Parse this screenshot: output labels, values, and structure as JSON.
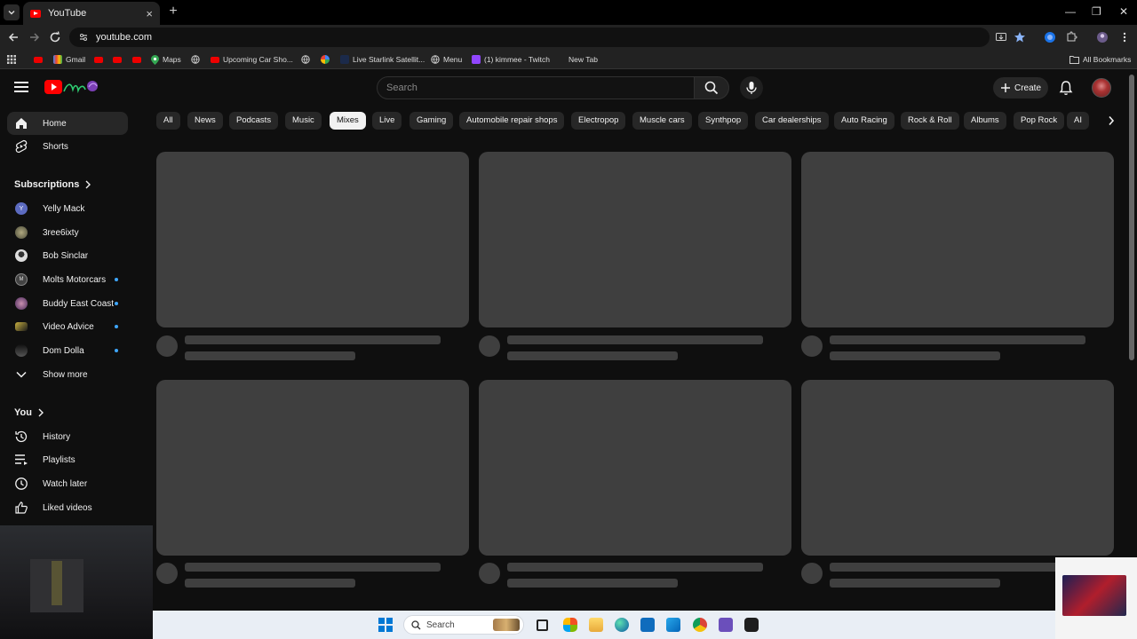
{
  "browser": {
    "tab_title": "YouTube",
    "tab_close": "×",
    "new_tab": "+",
    "url": "youtube.com",
    "window_controls": [
      "—",
      "❐",
      "✕"
    ],
    "bookmarks": [
      {
        "label": "Gmail",
        "icon": "gmail-icon"
      },
      {
        "label": "Maps",
        "icon": "maps-icon"
      },
      {
        "label": "Upcoming Car Sho...",
        "icon": "youtube-icon"
      },
      {
        "label": "Live Starlink Satellit...",
        "icon": "starlink-icon"
      },
      {
        "label": "Menu",
        "icon": "globe-icon"
      },
      {
        "label": "(1) kimmee - Twitch",
        "icon": "twitch-icon"
      },
      {
        "label": "New Tab",
        "icon": "blank-icon"
      }
    ],
    "all_bookmarks": "All Bookmarks"
  },
  "youtube": {
    "search_placeholder": "Search",
    "create_label": "Create",
    "sidebar": {
      "primary": [
        {
          "label": "Home",
          "active": true
        },
        {
          "label": "Shorts",
          "active": false
        }
      ],
      "subscriptions_heading": "Subscriptions",
      "subscriptions": [
        {
          "name": "Yelly Mack",
          "initial": "Y",
          "color": "#5c6bc0",
          "new": false
        },
        {
          "name": "3ree6ixty",
          "initial": "",
          "color": "#8d8d6a",
          "new": false
        },
        {
          "name": "Bob Sinclar",
          "initial": "",
          "color": "#d0d0d0",
          "new": false
        },
        {
          "name": "Molts Motorcars",
          "initial": "M",
          "color": "#555555",
          "new": true
        },
        {
          "name": "Buddy East Coast",
          "initial": "",
          "color": "#7a5a8a",
          "new": true
        },
        {
          "name": "Video Advice",
          "initial": "",
          "color": "#c8b040",
          "new": true
        },
        {
          "name": "Dom Dolla",
          "initial": "",
          "color": "#333333",
          "new": true
        }
      ],
      "show_more": "Show more",
      "you_heading": "You",
      "you_items": [
        {
          "label": "History",
          "icon": "history-icon"
        },
        {
          "label": "Playlists",
          "icon": "playlists-icon"
        },
        {
          "label": "Watch later",
          "icon": "clock-icon"
        },
        {
          "label": "Liked videos",
          "icon": "thumbs-up-icon"
        }
      ]
    },
    "chips": [
      "All",
      "News",
      "Podcasts",
      "Music",
      "Mixes",
      "Live",
      "Gaming",
      "Automobile repair shops",
      "Electropop",
      "Muscle cars",
      "Synthpop",
      "Car dealerships",
      "Auto Racing",
      "Rock & Roll",
      "Albums",
      "Pop Rock",
      "AI"
    ],
    "active_chip": "Mixes",
    "skeleton_cards": 6
  },
  "taskbar": {
    "search_label": "Search"
  },
  "colors": {
    "youtube_red": "#ff0000",
    "background": "#0f0f0f",
    "skeleton": "#3f3f3f",
    "new_dot": "#3ea6ff"
  }
}
